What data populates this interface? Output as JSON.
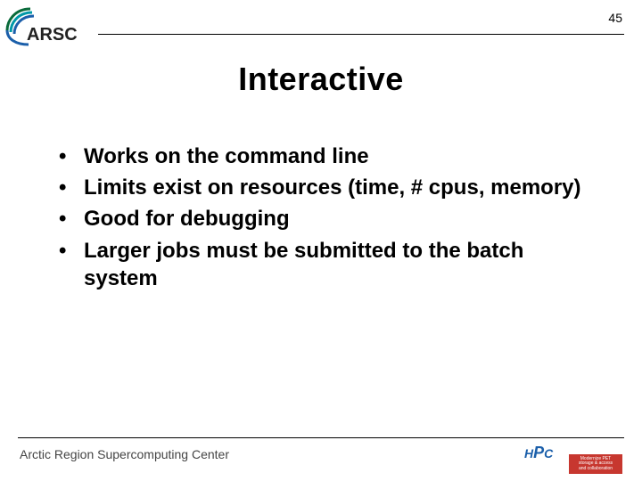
{
  "page_number": "45",
  "logo_text": "ARSC",
  "title": "Interactive",
  "bullets": [
    "Works on the command line",
    "Limits exist on resources (time, # cpus, memory)",
    "Good for debugging",
    "Larger jobs must be submitted to the batch system"
  ],
  "footer": {
    "org": "Arctic Region Supercomputing Center",
    "hpc_label": "HPC",
    "tag_line1": "Modernize PET",
    "tag_line2": "storage & access",
    "tag_line3": "and collaboration"
  }
}
